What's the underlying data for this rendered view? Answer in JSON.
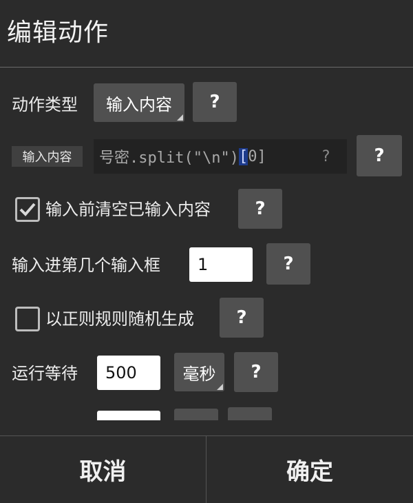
{
  "title": "编辑动作",
  "action_type": {
    "label": "动作类型",
    "value": "输入内容"
  },
  "input_content": {
    "tag": "输入内容",
    "code_before": "号密.split(\"\\n\")",
    "code_selected": "[",
    "code_after": "0]",
    "hint": "?"
  },
  "clear_before": {
    "label": "输入前清空已输入内容",
    "checked": true
  },
  "input_index": {
    "label": "输入进第几个输入框",
    "value": "1"
  },
  "regex_random": {
    "label": "以正则规则随机生成",
    "checked": false
  },
  "wait": {
    "label": "运行等待",
    "value": "500",
    "unit": "毫秒"
  },
  "help_label": "?",
  "footer": {
    "cancel": "取消",
    "confirm": "确定"
  }
}
